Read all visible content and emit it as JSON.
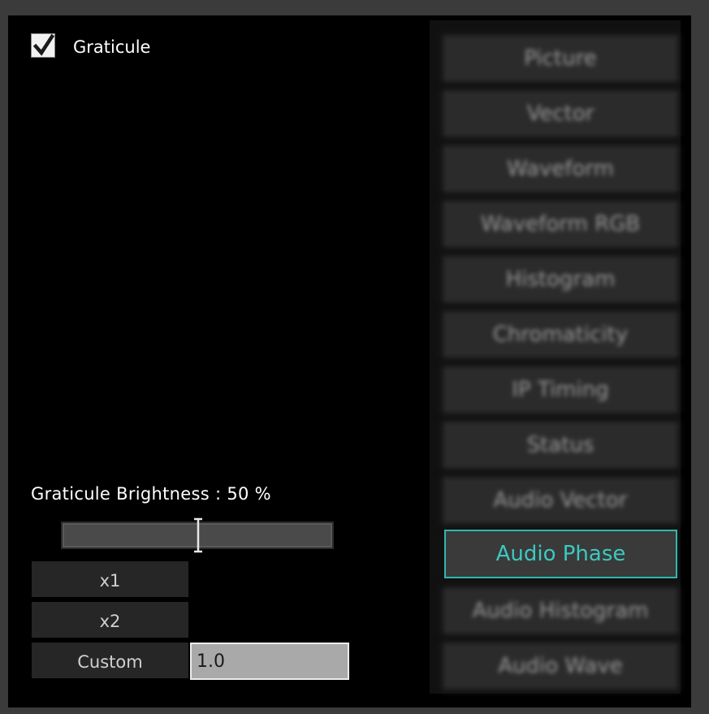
{
  "graticule": {
    "label": "Graticule",
    "checked": true
  },
  "brightness": {
    "label": "Graticule Brightness : 50 %",
    "value_percent": 50
  },
  "zoom": {
    "x1": "x1",
    "x2": "x2",
    "custom": "Custom",
    "custom_value": "1.0"
  },
  "modes": [
    {
      "label": "Picture",
      "active": false
    },
    {
      "label": "Vector",
      "active": false
    },
    {
      "label": "Waveform",
      "active": false
    },
    {
      "label": "Waveform RGB",
      "active": false
    },
    {
      "label": "Histogram",
      "active": false
    },
    {
      "label": "Chromaticity",
      "active": false
    },
    {
      "label": "IP Timing",
      "active": false
    },
    {
      "label": "Status",
      "active": false
    },
    {
      "label": "Audio Vector",
      "active": false
    },
    {
      "label": "Audio Phase",
      "active": true
    },
    {
      "label": "Audio Histogram",
      "active": false
    },
    {
      "label": "Audio Wave",
      "active": false
    }
  ],
  "colors": {
    "accent": "#2fb8b0",
    "panel_bg": "#000000",
    "button_bg": "#2b2b2b"
  }
}
